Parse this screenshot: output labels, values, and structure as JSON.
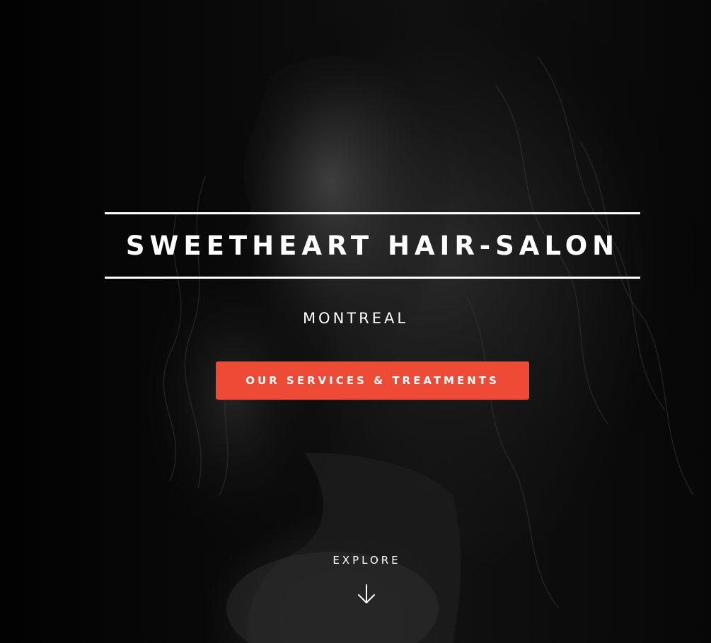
{
  "hero": {
    "title": "SWEETHEART HAIR-SALON",
    "subtitle": "MONTREAL",
    "cta_label": "OUR SERVICES & TREATMENTS",
    "explore_label": "EXPLORE",
    "explore_icon": "arrow-down-icon"
  },
  "colors": {
    "accent": "#ef4a36",
    "text": "#ffffff",
    "background": "#050505"
  }
}
